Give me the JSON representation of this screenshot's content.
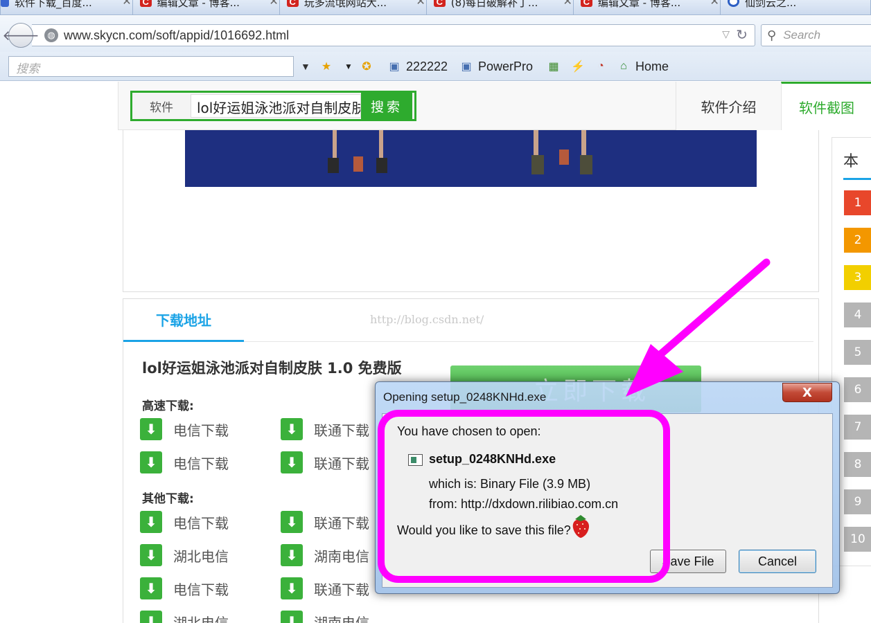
{
  "browser": {
    "tabs": [
      {
        "title": "软件下载_百度..."
      },
      {
        "title": "编辑文章 - 博客..."
      },
      {
        "title": "玩多流氓网站大..."
      },
      {
        "title": "(8)每日破解补丁..."
      },
      {
        "title": "编辑文章 - 博客..."
      },
      {
        "title": "仙剑云之..."
      }
    ],
    "url": "www.skycn.com/soft/appid/1016692.html",
    "search_placeholder": "Search",
    "toolbar_search_placeholder": "搜索",
    "bookmarks": [
      "222222",
      "PowerPro",
      "Home"
    ]
  },
  "site": {
    "search_category": "软件",
    "search_query": "lol好运姐泳池派对自制皮肤",
    "search_button": "搜索",
    "nav_tabs": [
      "软件介绍",
      "软件截图"
    ],
    "download_tab": "下载地址",
    "watermark": "http://blog.csdn.net/",
    "software_title": "lol好运姐泳池派对自制皮肤 1.0 免费版",
    "high_speed_label": "高速下载:",
    "other_label": "其他下载:",
    "big_button_text": "立即下载",
    "rank_header": "本",
    "rank_numbers": [
      "1",
      "2",
      "3",
      "4",
      "5",
      "6",
      "7",
      "8",
      "9",
      "10"
    ],
    "links_col1": [
      "电信下载",
      "电信下载",
      "电信下载",
      "湖北电信",
      "电信下载",
      "湖北电信"
    ],
    "links_col2": [
      "联通下载",
      "联通下载",
      "联通下载",
      "湖南电信",
      "联通下载",
      "湖南电信"
    ]
  },
  "dialog": {
    "title": "Opening setup_0248KNHd.exe",
    "close_label": "X",
    "intro": "You have chosen to open:",
    "filename": "setup_0248KNHd.exe",
    "which_is": "which is:  Binary File (3.9 MB)",
    "from": "from:  http://dxdown.rilibiao.com.cn",
    "question": "Would you like to save this file?",
    "save_button": "Save File",
    "cancel_button": "Cancel"
  },
  "colors": {
    "site_green": "#2eab2e",
    "site_blue": "#1aa3e6",
    "annotation_magenta": "#ff00ff",
    "rank_red": "#e8472b",
    "rank_orange": "#f39700",
    "rank_yellow": "#f2cf00",
    "rank_gray": "#b5b5b5"
  }
}
